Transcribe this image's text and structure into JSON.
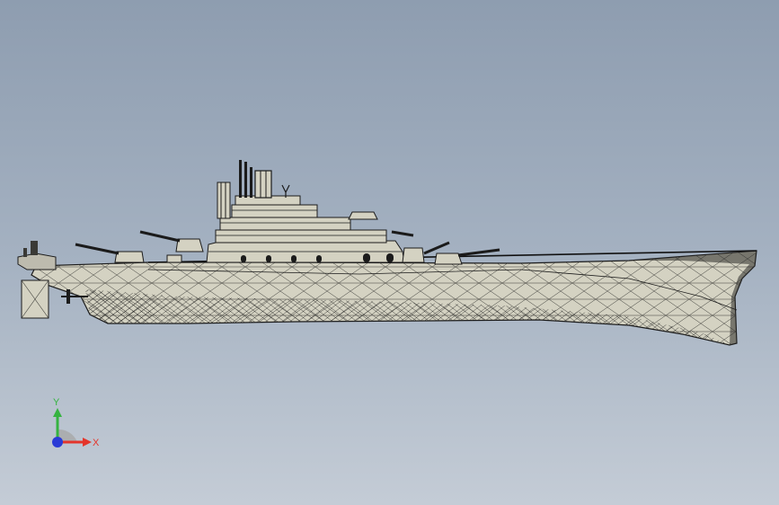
{
  "viewport": {
    "background_top": "#8e9db0",
    "background_bottom": "#c4ccd6",
    "model": {
      "description_icon": "battleship-model-icon",
      "fill_color": "#d4d2c2",
      "edge_color": "#1b1b1b"
    }
  },
  "triad": {
    "x_label": "X",
    "y_label": "Y",
    "x_color": "#e4352b",
    "y_color": "#35b340",
    "z_color": "#2a3bd6"
  }
}
